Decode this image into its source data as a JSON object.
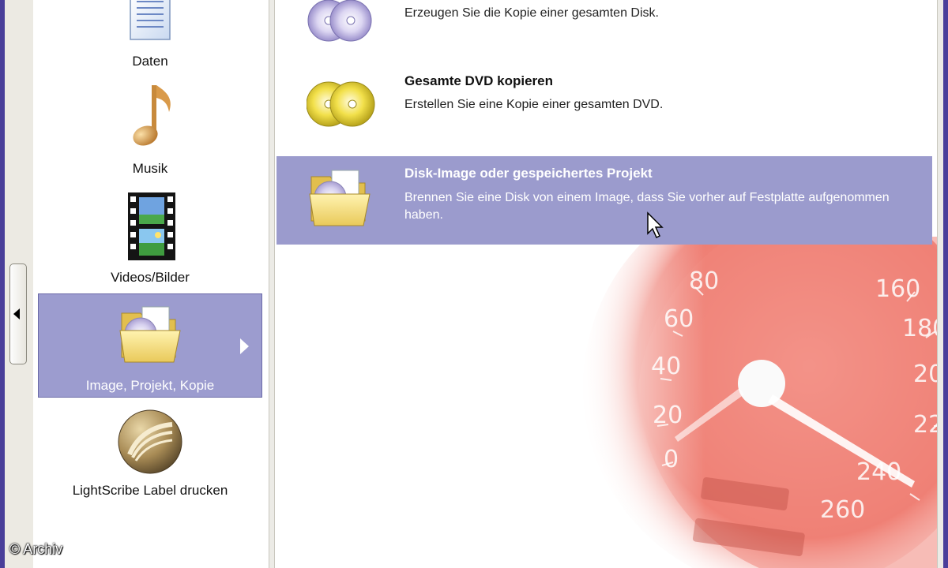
{
  "sidebar": {
    "items": [
      {
        "label": "Daten",
        "icon": "document-icon"
      },
      {
        "label": "Musik",
        "icon": "music-note-icon"
      },
      {
        "label": "Videos/Bilder",
        "icon": "film-strip-icon"
      },
      {
        "label": "Image, Projekt, Kopie",
        "icon": "folder-disc-icon",
        "selected": true
      },
      {
        "label": "LightScribe Label drucken",
        "icon": "lightscribe-icon"
      }
    ]
  },
  "main": {
    "options": [
      {
        "title": "",
        "desc": "Erzeugen Sie die Kopie einer gesamten Disk.",
        "icon": "discs-icon"
      },
      {
        "title": "Gesamte DVD kopieren",
        "desc": "Erstellen Sie eine Kopie einer gesamten DVD.",
        "icon": "gold-discs-icon"
      },
      {
        "title": "Disk-Image oder gespeichertes Projekt",
        "desc": "Brennen Sie eine Disk von einem Image, dass Sie vorher auf Festplatte aufgenommen haben.",
        "icon": "folder-disc-icon",
        "selected": true
      }
    ],
    "speedometer_labels": [
      "0",
      "20",
      "40",
      "60",
      "80",
      "160",
      "180",
      "20",
      "22",
      "240",
      "260"
    ]
  },
  "watermark": "© Archiv",
  "colors": {
    "selection": "#9b9bcd",
    "window_border": "#4a3f9a"
  }
}
